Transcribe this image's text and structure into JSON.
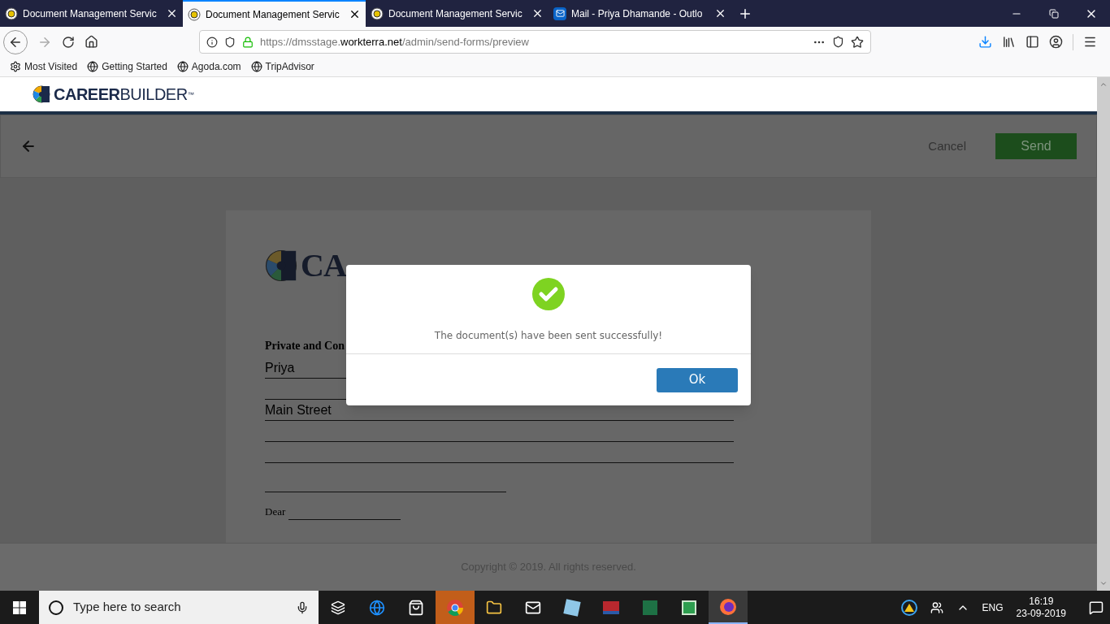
{
  "browser": {
    "tabs": [
      {
        "title": "Document Management Servic",
        "selected": false
      },
      {
        "title": "Document Management Servic",
        "selected": true
      },
      {
        "title": "Document Management Servic",
        "selected": false
      },
      {
        "title": "Mail - Priya Dhamande - Outlo",
        "selected": false,
        "kind": "mail"
      }
    ],
    "url": {
      "scheme": "https://dmsstage.",
      "domain": "workterra.net",
      "path": "/admin/send-forms/preview"
    },
    "bookmarks": [
      {
        "label": "Most Visited",
        "kind": "gear"
      },
      {
        "label": "Getting Started",
        "kind": "globe"
      },
      {
        "label": "Agoda.com",
        "kind": "globe"
      },
      {
        "label": "TripAdvisor",
        "kind": "globe"
      }
    ]
  },
  "header": {
    "logo": {
      "bold": "CAREER",
      "light": "BUILDER",
      "mark": "™"
    }
  },
  "action_bar": {
    "cancel": "Cancel",
    "send": "Send"
  },
  "document": {
    "logo": {
      "bold": "CA"
    },
    "heading": "Private and Con",
    "fields": [
      "Priya",
      "Main Street"
    ],
    "salutation": "Dear"
  },
  "dialog": {
    "message": "The document(s) have been sent successfully!",
    "ok": "Ok"
  },
  "footer": {
    "copyright": "Copyright © 2019. All rights reserved."
  },
  "taskbar": {
    "search_placeholder": "Type here to search",
    "language": "ENG",
    "time": "16:19",
    "date": "23-09-2019"
  }
}
